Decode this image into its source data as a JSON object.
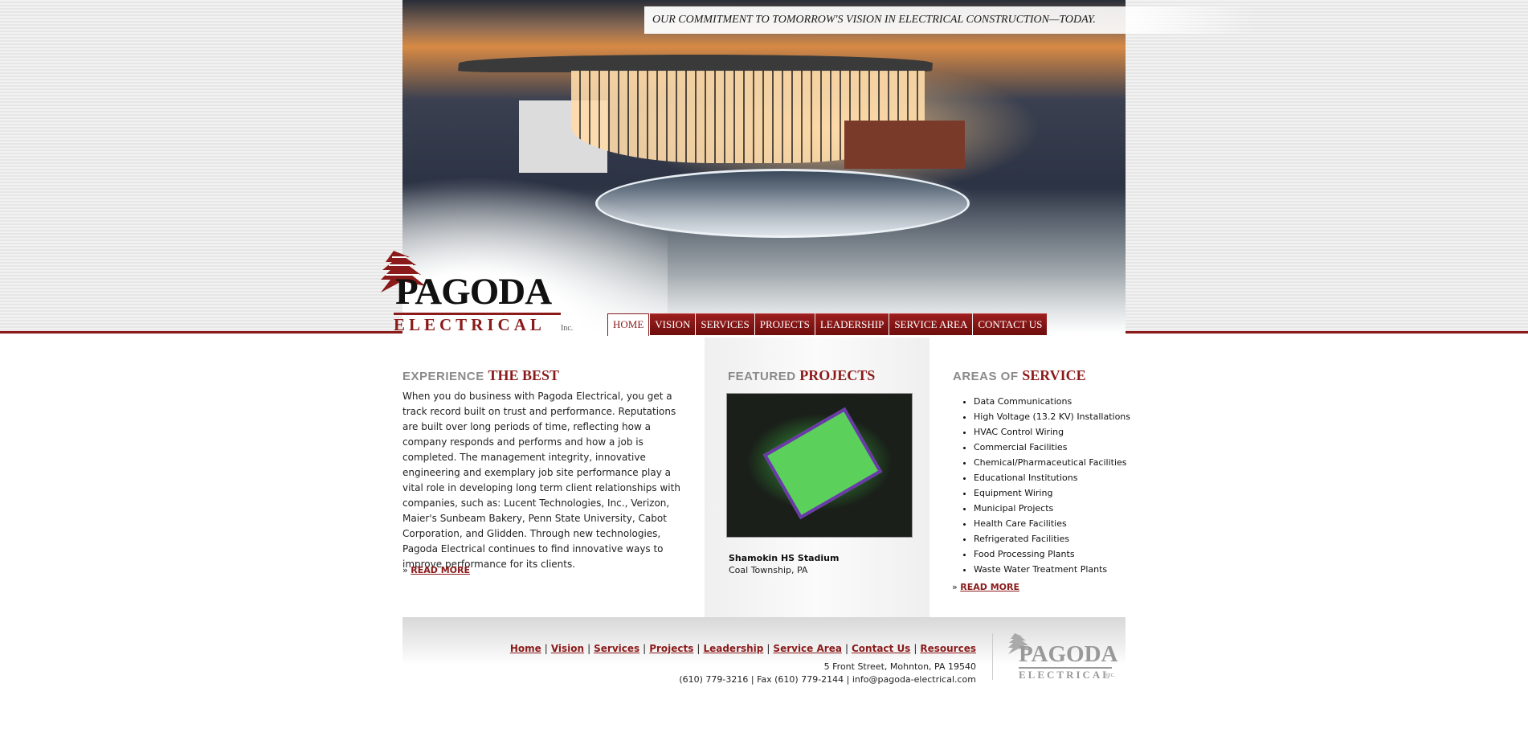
{
  "header": {
    "tagline": "OUR COMMITMENT TO TOMORROW'S VISION IN ELECTRICAL CONSTRUCTION—TODAY.",
    "logo_name": "PAGODA",
    "logo_sub": "ELECTRICAL",
    "logo_inc": "Inc."
  },
  "nav": {
    "items": [
      {
        "label": "HOME",
        "active": true
      },
      {
        "label": "VISION"
      },
      {
        "label": "SERVICES"
      },
      {
        "label": "PROJECTS"
      },
      {
        "label": "LEADERSHIP"
      },
      {
        "label": "SERVICE AREA"
      },
      {
        "label": "CONTACT US"
      }
    ]
  },
  "experience": {
    "title_grey": "EXPERIENCE",
    "title_red": "THE BEST",
    "body": "When you do business with Pagoda Electrical, you get a track record built on trust and performance. Reputations are built over long periods of time, reflecting how a company responds and performs and how a job is completed. The management integrity, innovative engineering and exemplary job site performance play a vital role in developing long term client relationships with companies, such as: Lucent Technologies, Inc., Verizon, Maier's Sunbeam Bakery, Penn State University, Cabot Corporation, and Glidden. Through new technologies, Pagoda Electrical continues to find innovative ways to improve performance for its clients.",
    "read_more": "READ MORE"
  },
  "projects": {
    "title_grey": "FEATURED",
    "title_red": "PROJECTS",
    "name": "Shamokin HS Stadium",
    "location": "Coal Township, PA"
  },
  "service": {
    "title_grey": "AREAS OF",
    "title_red": "SERVICE",
    "items": [
      "Data Communications",
      "High Voltage (13.2 KV) Installations",
      "HVAC Control Wiring",
      "Commercial Facilities",
      "Chemical/Pharmaceutical Facilities",
      "Educational Institutions",
      "Equipment Wiring",
      "Municipal Projects",
      "Health Care Facilities",
      "Refrigerated Facilities",
      "Food Processing Plants",
      "Waste Water Treatment Plants"
    ],
    "read_more": "READ MORE"
  },
  "footer": {
    "links": [
      "Home",
      "Vision",
      "Services",
      "Projects",
      "Leadership",
      "Service Area",
      "Contact Us",
      "Resources"
    ],
    "address": "5 Front Street, Mohnton, PA 19540",
    "contact": "(610) 779-3216 | Fax (610) 779-2144 | info@pagoda-electrical.com",
    "logo_name": "PAGODA",
    "logo_sub": "ELECTRICAL",
    "logo_inc": "Inc."
  },
  "colors": {
    "brand_red": "#8b1a1a"
  }
}
